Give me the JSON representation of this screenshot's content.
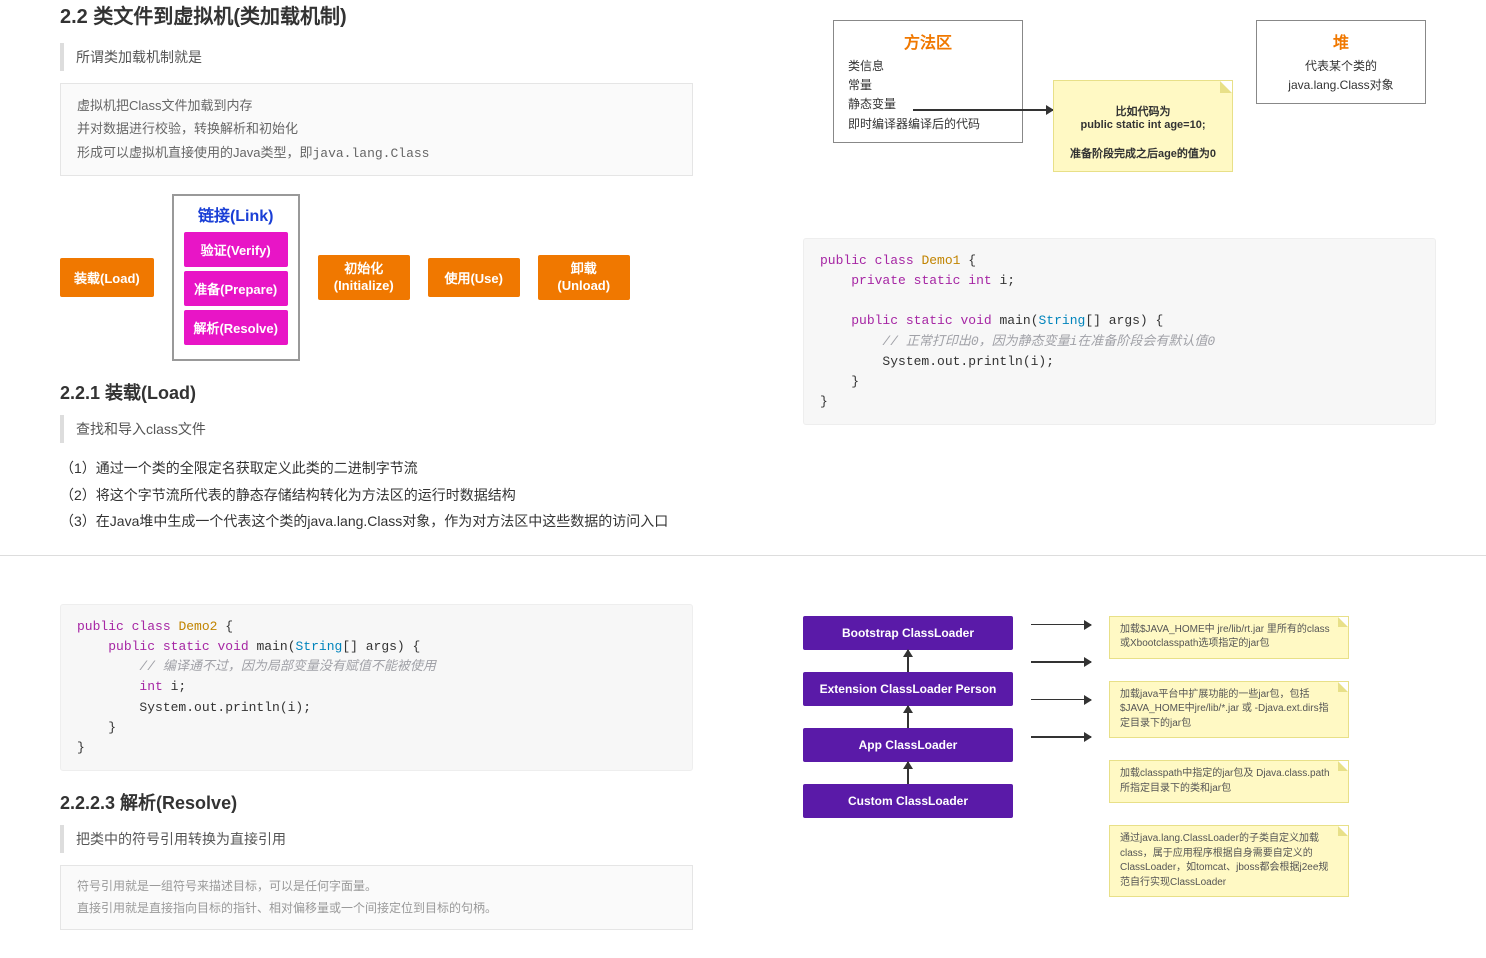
{
  "section22": {
    "title": "2.2 类文件到虚拟机(类加载机制)",
    "quote": "所谓类加载机制就是",
    "desc1": "虚拟机把Class文件加载到内存",
    "desc2": "并对数据进行校验，转换解析和初始化",
    "desc3_a": "形成可以虚拟机直接使用的Java类型，即",
    "desc3_b": "java.lang.Class",
    "flow": {
      "load": "装载(Load)",
      "link_title": "链接(Link)",
      "verify": "验证(Verify)",
      "prepare": "准备(Prepare)",
      "resolve": "解析(Resolve)",
      "init_l1": "初始化",
      "init_l2": "(Initialize)",
      "use": "使用(Use)",
      "unload_l1": "卸载",
      "unload_l2": "(Unload)"
    },
    "s221_title": "2.2.1 装载(Load)",
    "s221_quote": "查找和导入class文件",
    "step1": "（1）通过一个类的全限定名获取定义此类的二进制字节流",
    "step2": "（2）将这个字节流所代表的静态存储结构转化为方法区的运行时数据结构",
    "step3": "（3）在Java堆中生成一个代表这个类的java.lang.Class对象，作为对方法区中这些数据的访问入口"
  },
  "diagram_tr": {
    "method_area_title": "方法区",
    "ma_l1": "类信息",
    "ma_l2": "常量",
    "ma_l3": "静态变量",
    "ma_l4": "即时编译器编译后的代码",
    "heap_title": "堆",
    "heap_l1": "代表某个类的",
    "heap_l2": "java.lang.Class对象",
    "note_l1": "比如代码为",
    "note_l2": "public static int age=10;",
    "note_l3": "准备阶段完成之后age的值为0"
  },
  "code1": "public class Demo1 {\n    private static int i;\n\n    public static void main(String[] args) {\n        // 正常打印出0，因为静态变量i在准备阶段会有默认值0\n        System.out.println(i);\n    }\n}",
  "code2": "public class Demo2 {\n    public static void main(String[] args) {\n        // 编译通不过，因为局部变量没有赋值不能被使用\n        int i;\n        System.out.println(i);\n    }\n}",
  "s2223_title": "2.2.2.3 解析(Resolve)",
  "s2223_quote": "把类中的符号引用转换为直接引用",
  "s2223_note_l1": "符号引用就是一组符号来描述目标，可以是任何字面量。",
  "s2223_note_l2": "直接引用就是直接指向目标的指针、相对偏移量或一个间接定位到目标的句柄。",
  "classloaders": {
    "boot": "Bootstrap ClassLoader",
    "ext": "Extension ClassLoader  Person",
    "app": "App ClassLoader",
    "custom": "Custom ClassLoader",
    "note_boot": "加载$JAVA_HOME中 jre/lib/rt.jar 里所有的class或Xbootclasspath选项指定的jar包",
    "note_ext": "加载java平台中扩展功能的一些jar包，包括$JAVA_HOME中jre/lib/*.jar 或 -Djava.ext.dirs指定目录下的jar包",
    "note_app": "加载classpath中指定的jar包及 Djava.class.path 所指定目录下的类和jar包",
    "note_custom": "通过java.lang.ClassLoader的子类自定义加载class，属于应用程序根据自身需要自定义的ClassLoader，如tomcat、jboss都会根据j2ee规范自行实现ClassLoader"
  }
}
